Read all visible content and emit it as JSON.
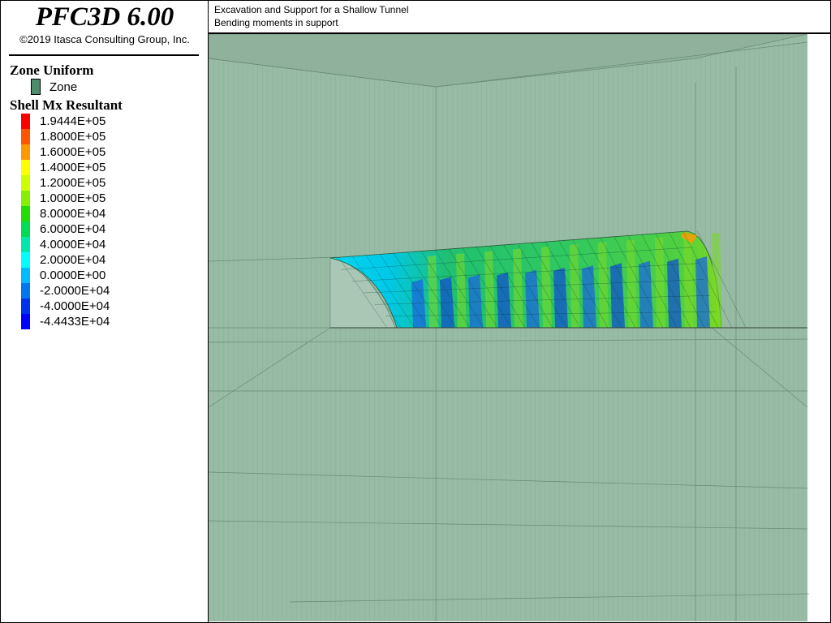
{
  "app": {
    "title": "PFC3D 6.00",
    "copyright": "©2019 Itasca Consulting Group, Inc."
  },
  "header": {
    "line1": "Excavation and Support for a Shallow Tunnel",
    "line2": "Bending moments in support"
  },
  "legend": {
    "zone_heading": "Zone Uniform",
    "zone_label": "Zone",
    "zone_color": "#4e8c6e",
    "shell_heading": "Shell Mx Resultant",
    "colorbar": [
      {
        "label": "1.9444E+05",
        "color": "#ff0000"
      },
      {
        "label": "1.8000E+05",
        "color": "#ff5500"
      },
      {
        "label": "1.6000E+05",
        "color": "#ff9900"
      },
      {
        "label": "1.4000E+05",
        "color": "#ffff00"
      },
      {
        "label": "1.2000E+05",
        "color": "#ccff00"
      },
      {
        "label": "1.0000E+05",
        "color": "#88ee00"
      },
      {
        "label": "8.0000E+04",
        "color": "#22dd00"
      },
      {
        "label": "6.0000E+04",
        "color": "#00dd55"
      },
      {
        "label": "4.0000E+04",
        "color": "#00e8aa"
      },
      {
        "label": "2.0000E+04",
        "color": "#00ffff"
      },
      {
        "label": "0.0000E+00",
        "color": "#00bbff"
      },
      {
        "label": "-2.0000E+04",
        "color": "#0077ee"
      },
      {
        "label": "-4.0000E+04",
        "color": "#0033ee"
      },
      {
        "label": "-4.4433E+04",
        "color": "#0000ff"
      }
    ]
  },
  "colors": {
    "zone_fill": "#97bba4",
    "mesh_line": "#5f7f6d"
  }
}
